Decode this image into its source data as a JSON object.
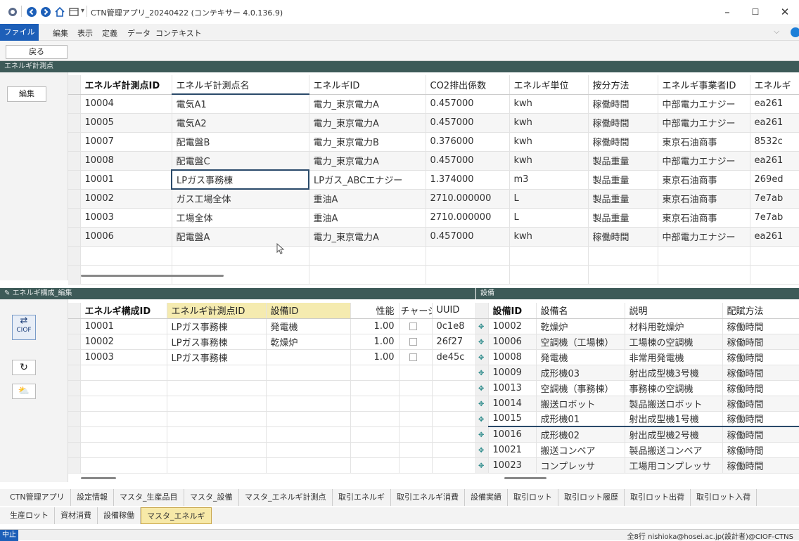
{
  "titlebar": {
    "title": "CTN管理アプリ_20240422 (コンテキサー 4.0.136.9)"
  },
  "menu": {
    "items": [
      "ファイル",
      "編集",
      "表示",
      "定義",
      "データ",
      "コンテキスト"
    ]
  },
  "toolbar": {
    "back_label": "戻る"
  },
  "energy_points": {
    "panel_title": "エネルギ計測点",
    "edit_label": "編集",
    "columns": [
      "エネルギ計測点ID",
      "エネルギ計測点名",
      "エネルギID",
      "CO2排出係数",
      "エネルギ単位",
      "按分方法",
      "エネルギ事業者ID",
      "エネルギ"
    ],
    "rows": [
      [
        "10004",
        "電気A1",
        "電力_東京電力A",
        "0.457000",
        "kwh",
        "稼働時間",
        "中部電力エナジー",
        "ea261"
      ],
      [
        "10005",
        "電気A2",
        "電力_東京電力A",
        "0.457000",
        "kwh",
        "稼働時間",
        "中部電力エナジー",
        "ea261"
      ],
      [
        "10007",
        "配電盤B",
        "電力_東京電力B",
        "0.376000",
        "kwh",
        "稼働時間",
        "東京石油商事",
        "8532c"
      ],
      [
        "10008",
        "配電盤C",
        "電力_東京電力A",
        "0.457000",
        "kwh",
        "製品重量",
        "中部電力エナジー",
        "ea261"
      ],
      [
        "10001",
        "LPガス事務棟",
        "LPガス_ABCエナジー",
        "1.374000",
        "m3",
        "製品重量",
        "東京石油商事",
        "269ed"
      ],
      [
        "10002",
        "ガス工場全体",
        "重油A",
        "2710.000000",
        "L",
        "製品重量",
        "東京石油商事",
        "7e7ab"
      ],
      [
        "10003",
        "工場全体",
        "重油A",
        "2710.000000",
        "L",
        "製品重量",
        "東京石油商事",
        "7e7ab"
      ],
      [
        "10006",
        "配電盤A",
        "電力_東京電力A",
        "0.457000",
        "kwh",
        "稼働時間",
        "中部電力エナジー",
        "ea261"
      ]
    ]
  },
  "composition": {
    "panel_title": "エネルギ構成_編集",
    "ciof_label": "CIOF",
    "columns": [
      "エネルギ構成ID",
      "エネルギ計測点ID",
      "設備ID",
      "性能",
      "チャージ",
      "UUID"
    ],
    "rows": [
      [
        "10001",
        "LPガス事務棟",
        "発電機",
        "1.00",
        "",
        "0c1e8"
      ],
      [
        "10002",
        "LPガス事務棟",
        "乾燥炉",
        "1.00",
        "",
        "26f27"
      ],
      [
        "10003",
        "LPガス事務棟",
        "",
        "1.00",
        "",
        "de45c"
      ]
    ]
  },
  "equipment": {
    "panel_title": "設備",
    "columns": [
      "設備ID",
      "設備名",
      "説明",
      "配賦方法"
    ],
    "rows": [
      [
        "10002",
        "乾燥炉",
        "材料用乾燥炉",
        "稼働時間"
      ],
      [
        "10006",
        "空調機（工場棟）",
        "工場棟の空調機",
        "稼働時間"
      ],
      [
        "10008",
        "発電機",
        "非常用発電機",
        "稼働時間"
      ],
      [
        "10009",
        "成形機03",
        "射出成型機3号機",
        "稼働時間"
      ],
      [
        "10013",
        "空調機（事務棟）",
        "事務棟の空調機",
        "稼働時間"
      ],
      [
        "10014",
        "搬送ロボット",
        "製品搬送ロボット",
        "稼働時間"
      ],
      [
        "10015",
        "成形機01",
        "射出成型機1号機",
        "稼働時間"
      ],
      [
        "10016",
        "成形機02",
        "射出成型機2号機",
        "稼働時間"
      ],
      [
        "10021",
        "搬送コンベア",
        "製品搬送コンベア",
        "稼働時間"
      ],
      [
        "10023",
        "コンプレッサ",
        "工場用コンプレッサ",
        "稼働時間"
      ]
    ]
  },
  "tabs_row1": [
    "CTN管理アプリ",
    "設定情報",
    "マスタ_生産品目",
    "マスタ_設備",
    "マスタ_エネルギ計測点",
    "取引エネルギ",
    "取引エネルギ消費",
    "設備実績",
    "取引ロット",
    "取引ロット履歴",
    "取引ロット出荷",
    "取引ロット入荷"
  ],
  "tabs_row2": [
    "生産ロット",
    "資材消費",
    "設備稼働",
    "マスタ_エネルギ"
  ],
  "status": {
    "stop_label": "中止",
    "info": "全8行  nishioka@hosei.ac.jp(設計者)@CIOF-CTNS"
  }
}
